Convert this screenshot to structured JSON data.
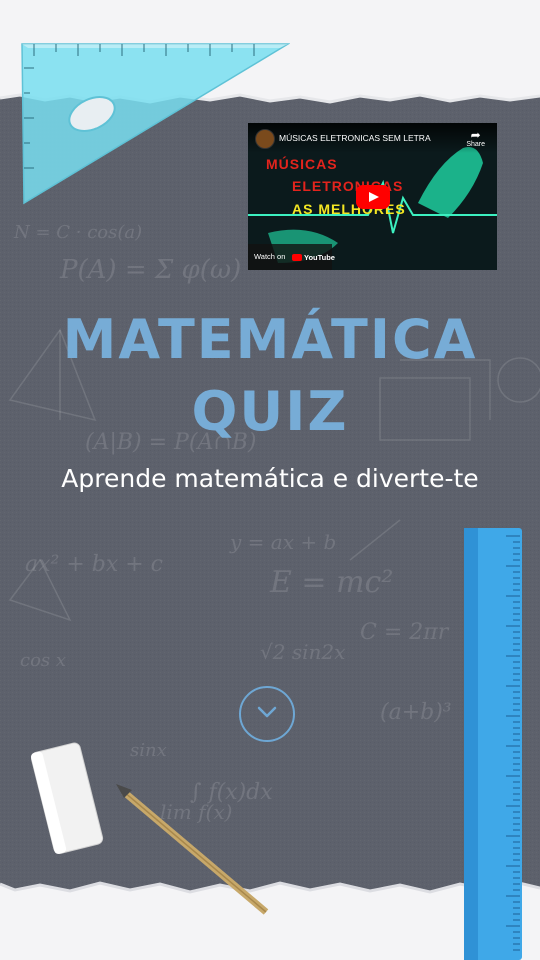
{
  "hero": {
    "title_line1": "MATEMÁTICA",
    "title_line2": "QUIZ",
    "subtitle": "Aprende matemática e diverte-te"
  },
  "video": {
    "title": "MÚSICAS ELETRONICAS SEM LETRA",
    "share_label": "Share",
    "thumb_line1": "MÚSICAS",
    "thumb_line2": "ELETRONICAS",
    "thumb_line3": "AS MELHORES",
    "watch_label": "Watch on",
    "brand": "YouTube"
  },
  "scroll_button": {
    "icon": "chevron-down-icon"
  },
  "board_formulas": [
    "P(A) = Σ φ(ω)",
    "E = mc²",
    "ax² + bx + c",
    "N = C · cos(a)",
    "(A|B) = P(A∩B)",
    "sinx",
    "cos x",
    "lim f(x)",
    "C = 2πr",
    "√2 sin2x",
    "(a+b)³",
    "y = ax + b",
    "∫ f(x)dx"
  ],
  "colors": {
    "board": "#5d616c",
    "title": "#77acd6",
    "subtitle": "#ffffff",
    "accent": "#6ea7d4"
  }
}
